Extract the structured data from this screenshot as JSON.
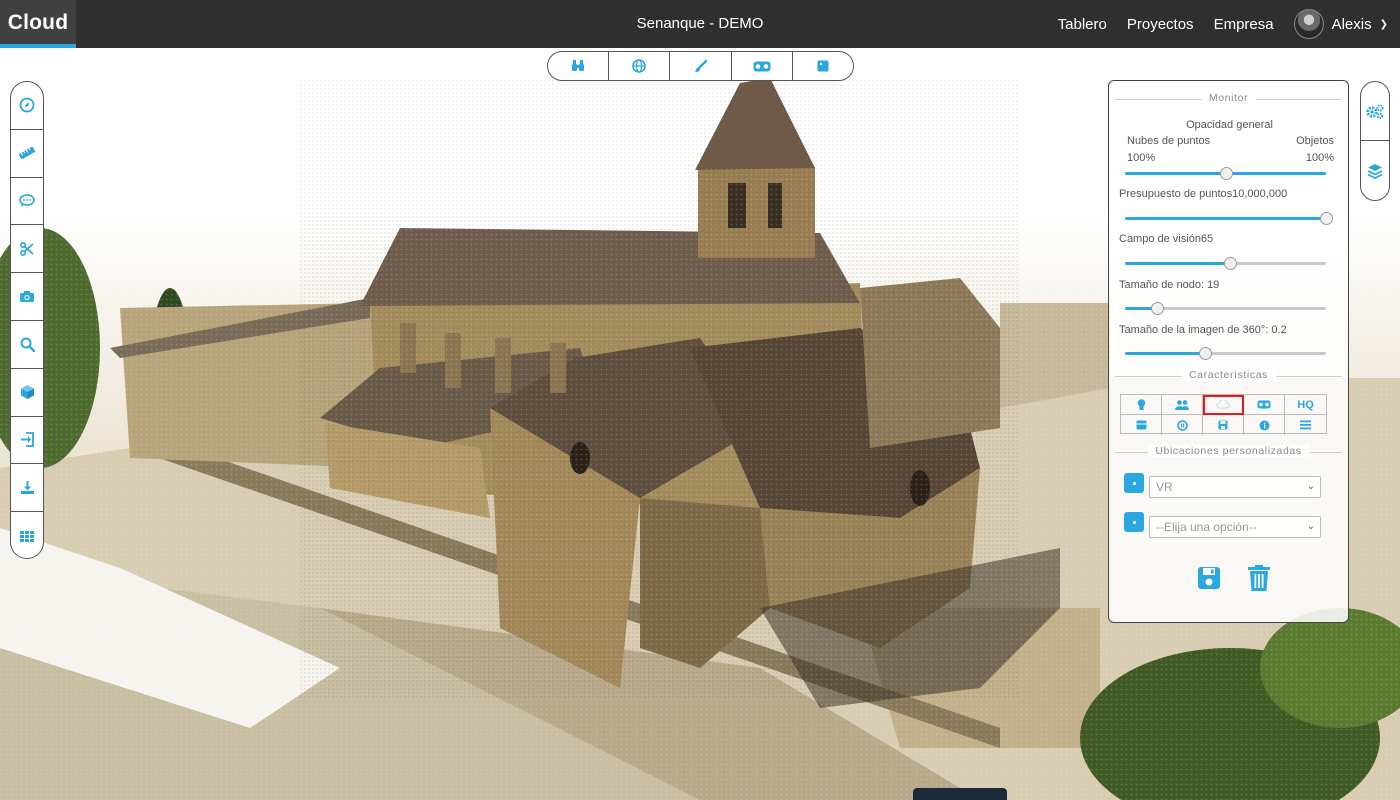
{
  "app": {
    "brand": "Cloud",
    "project_title": "Senanque - DEMO"
  },
  "nav": {
    "links": [
      "Tablero",
      "Proyectos",
      "Empresa"
    ],
    "user": "Alexis"
  },
  "colors": {
    "accent": "#2aa6e0",
    "topbar": "#2f2f2f",
    "highlight": "#e01b24"
  },
  "top_tools": [
    "binoculars-icon",
    "globe-icon",
    "brush-icon",
    "vr-goggles-icon",
    "square-icon"
  ],
  "left_tools": [
    "compass-icon",
    "ruler-icon",
    "comment-icon",
    "scissors-icon",
    "camera-icon",
    "search-icon",
    "cube-icon",
    "import-icon",
    "download-icon",
    "grid-icon"
  ],
  "right_tools": [
    "settings-icon",
    "layers-icon"
  ],
  "panel": {
    "title": "Monitor",
    "opacity_title": "Opacidad general",
    "left_label": "Nubes de puntos",
    "right_label": "Objetos",
    "left_value": "100%",
    "right_value": "100%",
    "opacity_level": 0.5,
    "budget_label": "Presupuesto de puntos",
    "budget_value": "10,000,000",
    "budget_level": 1.0,
    "fov_label": "Campo de visión",
    "fov_value": "65",
    "fov_level": 0.52,
    "node_label": "Tamaño de nodo: 19",
    "node_level": 0.16,
    "image360_label": "Tamaño de la imagen de 360°: 0.2",
    "image360_level": 0.4,
    "features_title": "Características",
    "features": [
      "bulb-icon",
      "users-icon",
      "cloud-icon",
      "vr-goggles-icon",
      "HQ",
      "box-icon",
      "pause-icon",
      "save-icon",
      "info-icon",
      "list-icon"
    ],
    "locations_title": "Ubicaciones personalizadas",
    "location_select_1": "VR",
    "location_select_2": "--Elija una opción--"
  }
}
